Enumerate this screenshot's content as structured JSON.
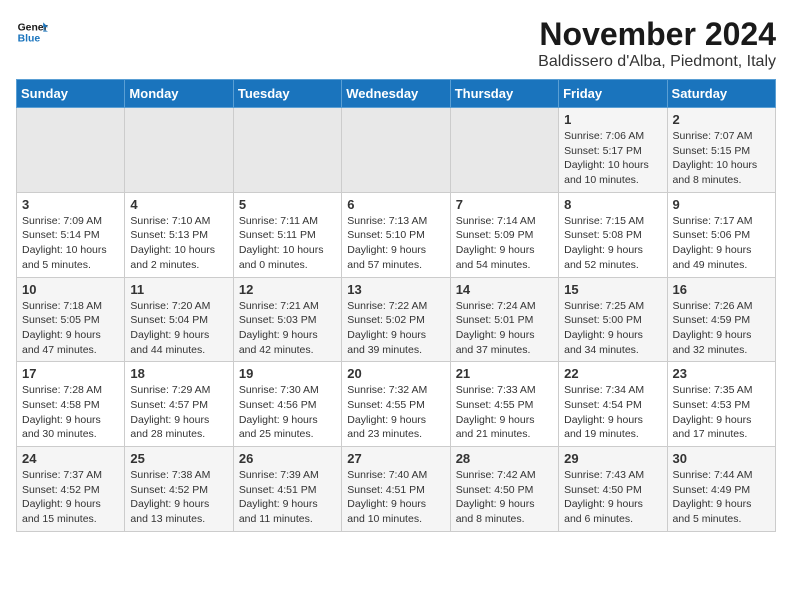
{
  "logo": {
    "line1": "General",
    "line2": "Blue"
  },
  "title": "November 2024",
  "location": "Baldissero d'Alba, Piedmont, Italy",
  "weekdays": [
    "Sunday",
    "Monday",
    "Tuesday",
    "Wednesday",
    "Thursday",
    "Friday",
    "Saturday"
  ],
  "weeks": [
    [
      {
        "day": "",
        "info": ""
      },
      {
        "day": "",
        "info": ""
      },
      {
        "day": "",
        "info": ""
      },
      {
        "day": "",
        "info": ""
      },
      {
        "day": "",
        "info": ""
      },
      {
        "day": "1",
        "info": "Sunrise: 7:06 AM\nSunset: 5:17 PM\nDaylight: 10 hours\nand 10 minutes."
      },
      {
        "day": "2",
        "info": "Sunrise: 7:07 AM\nSunset: 5:15 PM\nDaylight: 10 hours\nand 8 minutes."
      }
    ],
    [
      {
        "day": "3",
        "info": "Sunrise: 7:09 AM\nSunset: 5:14 PM\nDaylight: 10 hours\nand 5 minutes."
      },
      {
        "day": "4",
        "info": "Sunrise: 7:10 AM\nSunset: 5:13 PM\nDaylight: 10 hours\nand 2 minutes."
      },
      {
        "day": "5",
        "info": "Sunrise: 7:11 AM\nSunset: 5:11 PM\nDaylight: 10 hours\nand 0 minutes."
      },
      {
        "day": "6",
        "info": "Sunrise: 7:13 AM\nSunset: 5:10 PM\nDaylight: 9 hours\nand 57 minutes."
      },
      {
        "day": "7",
        "info": "Sunrise: 7:14 AM\nSunset: 5:09 PM\nDaylight: 9 hours\nand 54 minutes."
      },
      {
        "day": "8",
        "info": "Sunrise: 7:15 AM\nSunset: 5:08 PM\nDaylight: 9 hours\nand 52 minutes."
      },
      {
        "day": "9",
        "info": "Sunrise: 7:17 AM\nSunset: 5:06 PM\nDaylight: 9 hours\nand 49 minutes."
      }
    ],
    [
      {
        "day": "10",
        "info": "Sunrise: 7:18 AM\nSunset: 5:05 PM\nDaylight: 9 hours\nand 47 minutes."
      },
      {
        "day": "11",
        "info": "Sunrise: 7:20 AM\nSunset: 5:04 PM\nDaylight: 9 hours\nand 44 minutes."
      },
      {
        "day": "12",
        "info": "Sunrise: 7:21 AM\nSunset: 5:03 PM\nDaylight: 9 hours\nand 42 minutes."
      },
      {
        "day": "13",
        "info": "Sunrise: 7:22 AM\nSunset: 5:02 PM\nDaylight: 9 hours\nand 39 minutes."
      },
      {
        "day": "14",
        "info": "Sunrise: 7:24 AM\nSunset: 5:01 PM\nDaylight: 9 hours\nand 37 minutes."
      },
      {
        "day": "15",
        "info": "Sunrise: 7:25 AM\nSunset: 5:00 PM\nDaylight: 9 hours\nand 34 minutes."
      },
      {
        "day": "16",
        "info": "Sunrise: 7:26 AM\nSunset: 4:59 PM\nDaylight: 9 hours\nand 32 minutes."
      }
    ],
    [
      {
        "day": "17",
        "info": "Sunrise: 7:28 AM\nSunset: 4:58 PM\nDaylight: 9 hours\nand 30 minutes."
      },
      {
        "day": "18",
        "info": "Sunrise: 7:29 AM\nSunset: 4:57 PM\nDaylight: 9 hours\nand 28 minutes."
      },
      {
        "day": "19",
        "info": "Sunrise: 7:30 AM\nSunset: 4:56 PM\nDaylight: 9 hours\nand 25 minutes."
      },
      {
        "day": "20",
        "info": "Sunrise: 7:32 AM\nSunset: 4:55 PM\nDaylight: 9 hours\nand 23 minutes."
      },
      {
        "day": "21",
        "info": "Sunrise: 7:33 AM\nSunset: 4:55 PM\nDaylight: 9 hours\nand 21 minutes."
      },
      {
        "day": "22",
        "info": "Sunrise: 7:34 AM\nSunset: 4:54 PM\nDaylight: 9 hours\nand 19 minutes."
      },
      {
        "day": "23",
        "info": "Sunrise: 7:35 AM\nSunset: 4:53 PM\nDaylight: 9 hours\nand 17 minutes."
      }
    ],
    [
      {
        "day": "24",
        "info": "Sunrise: 7:37 AM\nSunset: 4:52 PM\nDaylight: 9 hours\nand 15 minutes."
      },
      {
        "day": "25",
        "info": "Sunrise: 7:38 AM\nSunset: 4:52 PM\nDaylight: 9 hours\nand 13 minutes."
      },
      {
        "day": "26",
        "info": "Sunrise: 7:39 AM\nSunset: 4:51 PM\nDaylight: 9 hours\nand 11 minutes."
      },
      {
        "day": "27",
        "info": "Sunrise: 7:40 AM\nSunset: 4:51 PM\nDaylight: 9 hours\nand 10 minutes."
      },
      {
        "day": "28",
        "info": "Sunrise: 7:42 AM\nSunset: 4:50 PM\nDaylight: 9 hours\nand 8 minutes."
      },
      {
        "day": "29",
        "info": "Sunrise: 7:43 AM\nSunset: 4:50 PM\nDaylight: 9 hours\nand 6 minutes."
      },
      {
        "day": "30",
        "info": "Sunrise: 7:44 AM\nSunset: 4:49 PM\nDaylight: 9 hours\nand 5 minutes."
      }
    ]
  ]
}
